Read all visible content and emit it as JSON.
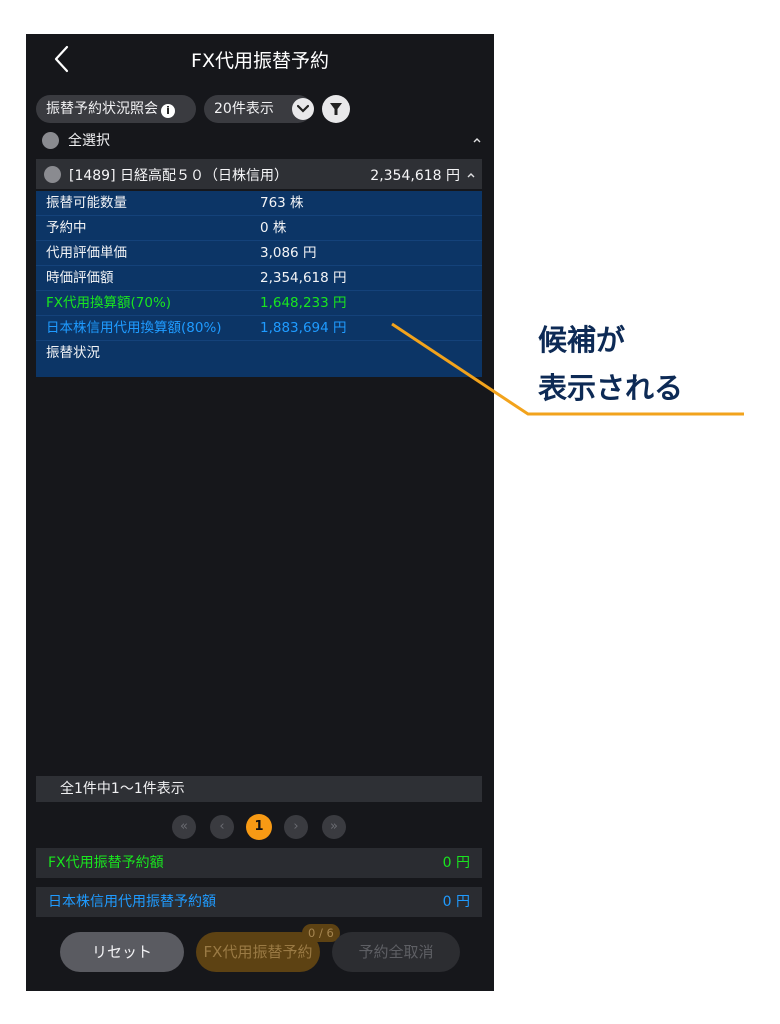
{
  "header": {
    "title": "FX代用振替予約"
  },
  "toolbar": {
    "status_label": "振替予約状況照会",
    "count_label": "20件表示"
  },
  "select_all": {
    "label": "全選択"
  },
  "item": {
    "name": "[1489] 日経高配５０（日株信用）",
    "amount": "2,354,618 円",
    "details": [
      {
        "label": "振替可能数量",
        "value": "763 株",
        "color": "#f3f4f6"
      },
      {
        "label": "予約中",
        "value": "0 株",
        "color": "#f3f4f6"
      },
      {
        "label": "代用評価単価",
        "value": "3,086 円",
        "color": "#f3f4f6"
      },
      {
        "label": "時価評価額",
        "value": "2,354,618 円",
        "color": "#f3f4f6"
      },
      {
        "label": "FX代用換算額(70%)",
        "value": "1,648,233 円",
        "color": "#19e51f"
      },
      {
        "label": "日本株信用代用換算額(80%)",
        "value": "1,883,694 円",
        "color": "#1f9bff"
      },
      {
        "label": "振替状況",
        "value": "",
        "color": "#f3f4f6"
      }
    ]
  },
  "summary": {
    "text": "全1件中1〜1件表示"
  },
  "pager": {
    "current": "1"
  },
  "totals": {
    "fx": {
      "label": "FX代用振替予約額",
      "value": "0 円",
      "color": "#19e51f"
    },
    "jp": {
      "label": "日本株信用代用振替予約額",
      "value": "0 円",
      "color": "#1f9bff"
    }
  },
  "buttons": {
    "reset": "リセット",
    "fx_reserve": "FX代用振替予約",
    "fx_badge": "0 / 6",
    "cancel_all": "予約全取消"
  },
  "annotation": {
    "line1": "候補が",
    "line2": "表示される",
    "color": "#f2a31c"
  }
}
